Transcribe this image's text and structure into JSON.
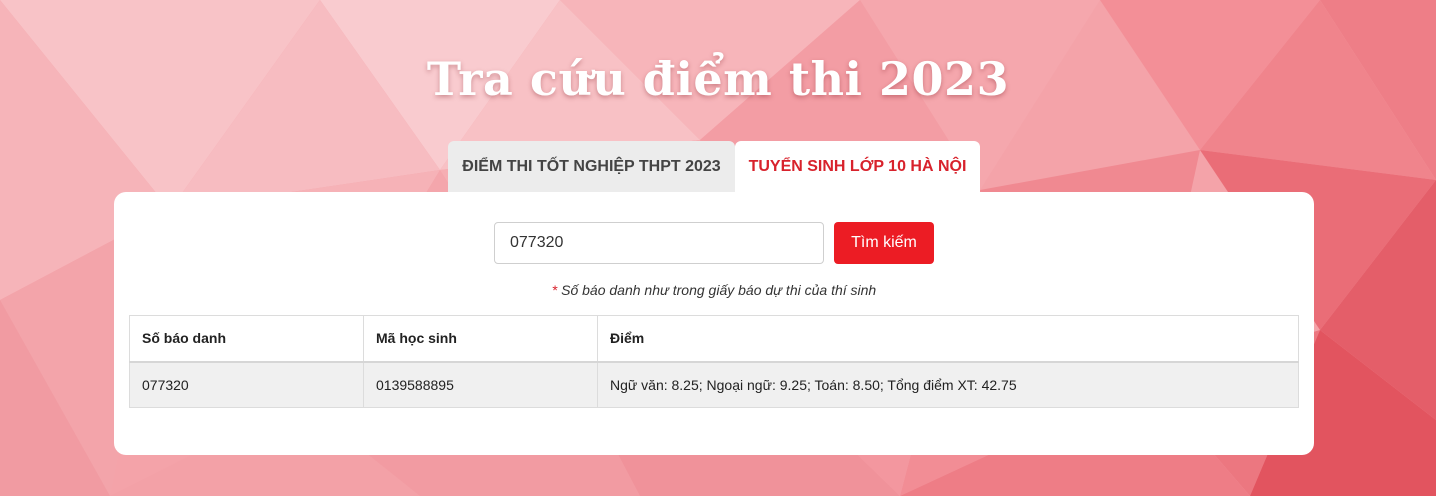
{
  "header": {
    "title": "Tra cứu điểm thi 2023"
  },
  "tabs": [
    {
      "label": "ĐIỂM THI TỐT NGHIỆP THPT 2023",
      "active": false
    },
    {
      "label": "TUYỂN SINH LỚP 10 HÀ NỘI",
      "active": true
    }
  ],
  "search": {
    "value": "077320",
    "button_label": "Tìm kiếm",
    "hint_marker": "*",
    "hint": "Số báo danh như trong giấy báo dự thi của thí sinh"
  },
  "results": {
    "columns": [
      "Số báo danh",
      "Mã học sinh",
      "Điểm"
    ],
    "rows": [
      [
        "077320",
        "0139588895",
        "Ngữ văn: 8.25; Ngoại ngữ: 9.25; Toán: 8.50; Tổng điểm XT: 42.75"
      ]
    ]
  },
  "colors": {
    "accent": "#ec1c24",
    "active_tab_text": "#d8222c",
    "background": "#f2a0a6"
  }
}
